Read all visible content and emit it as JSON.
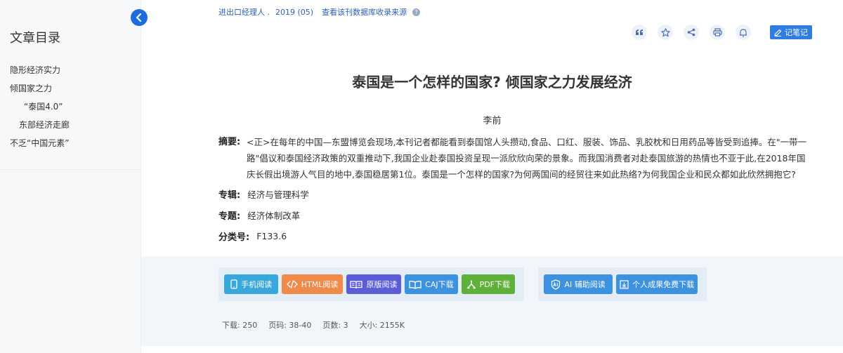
{
  "sidebar": {
    "title": "文章目录",
    "items": [
      {
        "label": "隐形经济实力",
        "level": 1
      },
      {
        "label": "倾国家之力",
        "level": 1
      },
      {
        "label": "“泰国4.0”",
        "level": 3
      },
      {
        "label": "东部经济走廊",
        "level": 2
      },
      {
        "label": "不乏“中国元素”",
        "level": 1
      }
    ]
  },
  "source": {
    "journal": "进出口经理人 .",
    "year_issue": "2019 (05)",
    "db_link": "查看该刊数据库收录来源",
    "help": "?"
  },
  "toolbar": {
    "icons": [
      "quote-icon",
      "favorite-star-icon",
      "share-icon",
      "print-icon",
      "bell-icon"
    ],
    "note_label": "记笔记"
  },
  "article": {
    "title": "泰国是一个怎样的国家? 倾国家之力发展经济",
    "author": "李前",
    "abstract_label": "摘要:",
    "abstract": "<正>在每年的中国—东盟博览会现场,本刊记者都能看到泰国馆人头攒动,食品、口红、服装、饰品、乳胶枕和日用药品等皆受到追捧。在\"一带一路\"倡议和泰国经济政策的双重推动下,我国企业赴泰国投资呈现一派欣欣向荣的景象。而我国消费者对赴泰国旅游的热情也不亚于此,在2018年国庆长假出境游人气目的地中,泰国稳居第1位。泰国是一个怎样的国家?为何两国间的经贸往来如此热络?为何我国企业和民众都如此欣然拥抱它?",
    "series_label": "专辑:",
    "series": "经济与管理科学",
    "topic_label": "专题:",
    "topic": "经济体制改革",
    "class_label": "分类号:",
    "class_no": "F133.6"
  },
  "actions": {
    "mobile": "手机阅读",
    "html": "HTML阅读",
    "original": "原版阅读",
    "caj": "CAJ下载",
    "pdf": "PDF下载",
    "ai": "AI 辅助阅读",
    "free": "个人成果免费下载"
  },
  "stats": {
    "downloads": "下载:  250",
    "pages": "页码:  38-40",
    "page_count": "页数:  3",
    "size": "大小:  2155K"
  },
  "colors": {
    "accent": "#1d6ce0",
    "link": "#2c5fb4",
    "mobile": "#38a8dc",
    "html": "#f08a4b",
    "original": "#5c5bd8",
    "caj": "#3d92e0",
    "pdf": "#5fb03a"
  }
}
